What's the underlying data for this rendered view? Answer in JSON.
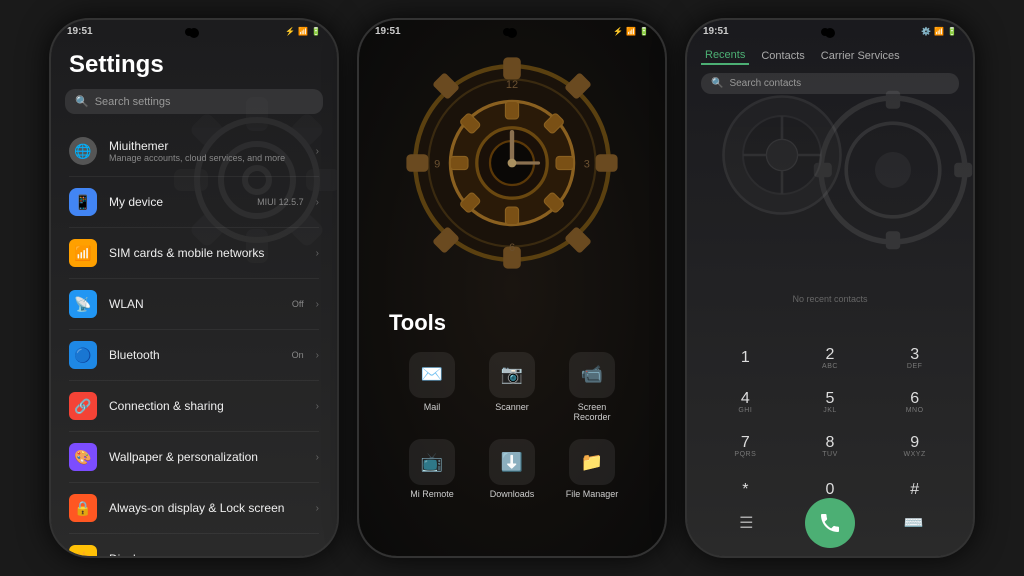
{
  "phone1": {
    "status_time": "19:51",
    "title": "Settings",
    "search_placeholder": "Search settings",
    "items": [
      {
        "id": "miuithemer",
        "icon": "🌐",
        "title": "Miuithemer",
        "sub": "Manage accounts, cloud services, and more",
        "right": "",
        "color": "#555"
      },
      {
        "id": "mydevice",
        "icon": "📱",
        "title": "My device",
        "sub": "",
        "right": "MIUI 12.5.7",
        "color": "#4285F4"
      },
      {
        "id": "simcards",
        "icon": "📶",
        "title": "SIM cards & mobile networks",
        "sub": "",
        "right": "",
        "color": "#FFA000"
      },
      {
        "id": "wlan",
        "icon": "📡",
        "title": "WLAN",
        "sub": "",
        "right": "Off",
        "color": "#2196F3"
      },
      {
        "id": "bluetooth",
        "icon": "🔵",
        "title": "Bluetooth",
        "sub": "",
        "right": "On",
        "color": "#1E88E5"
      },
      {
        "id": "connection",
        "icon": "🔗",
        "title": "Connection & sharing",
        "sub": "",
        "right": "",
        "color": "#F44336"
      },
      {
        "id": "wallpaper",
        "icon": "🎨",
        "title": "Wallpaper & personalization",
        "sub": "",
        "right": "",
        "color": "#7C4DFF"
      },
      {
        "id": "lockscreen",
        "icon": "🔒",
        "title": "Always-on display & Lock screen",
        "sub": "",
        "right": "",
        "color": "#FF5722"
      },
      {
        "id": "display",
        "icon": "☀️",
        "title": "Display",
        "sub": "",
        "right": "",
        "color": "#FFC107"
      }
    ]
  },
  "phone2": {
    "status_time": "19:51",
    "tools_label": "Tools",
    "apps": [
      [
        {
          "id": "mail",
          "icon": "✉️",
          "label": "Mail"
        },
        {
          "id": "scanner",
          "icon": "📷",
          "label": "Scanner"
        },
        {
          "id": "screen-recorder",
          "icon": "📹",
          "label": "Screen\nRecorder"
        }
      ],
      [
        {
          "id": "mi-remote",
          "icon": "📺",
          "label": "Mi Remote"
        },
        {
          "id": "downloads",
          "icon": "⬇️",
          "label": "Downloads"
        },
        {
          "id": "file-manager",
          "icon": "📁",
          "label": "File\nManager"
        }
      ]
    ]
  },
  "phone3": {
    "status_time": "19:51",
    "gear_icon": "⚙️",
    "tabs": [
      {
        "id": "recents",
        "label": "Recents",
        "active": true
      },
      {
        "id": "contacts",
        "label": "Contacts",
        "active": false
      },
      {
        "id": "carrier",
        "label": "Carrier Services",
        "active": false
      }
    ],
    "search_placeholder": "Search contacts",
    "no_contacts_label": "No recent contacts",
    "numpad": [
      [
        {
          "num": "1",
          "letters": ""
        },
        {
          "num": "2",
          "letters": "ABC"
        },
        {
          "num": "3",
          "letters": "DEF"
        }
      ],
      [
        {
          "num": "4",
          "letters": "GHI"
        },
        {
          "num": "5",
          "letters": "JKL"
        },
        {
          "num": "6",
          "letters": "MNO"
        }
      ],
      [
        {
          "num": "7",
          "letters": "PQRS"
        },
        {
          "num": "8",
          "letters": "TUV"
        },
        {
          "num": "9",
          "letters": "WXYZ"
        }
      ],
      [
        {
          "num": "*",
          "letters": ""
        },
        {
          "num": "0",
          "letters": ""
        },
        {
          "num": "#",
          "letters": ""
        }
      ]
    ],
    "bottom_buttons": {
      "menu": "☰",
      "call": "📞",
      "dialpad": "⌨️"
    }
  }
}
